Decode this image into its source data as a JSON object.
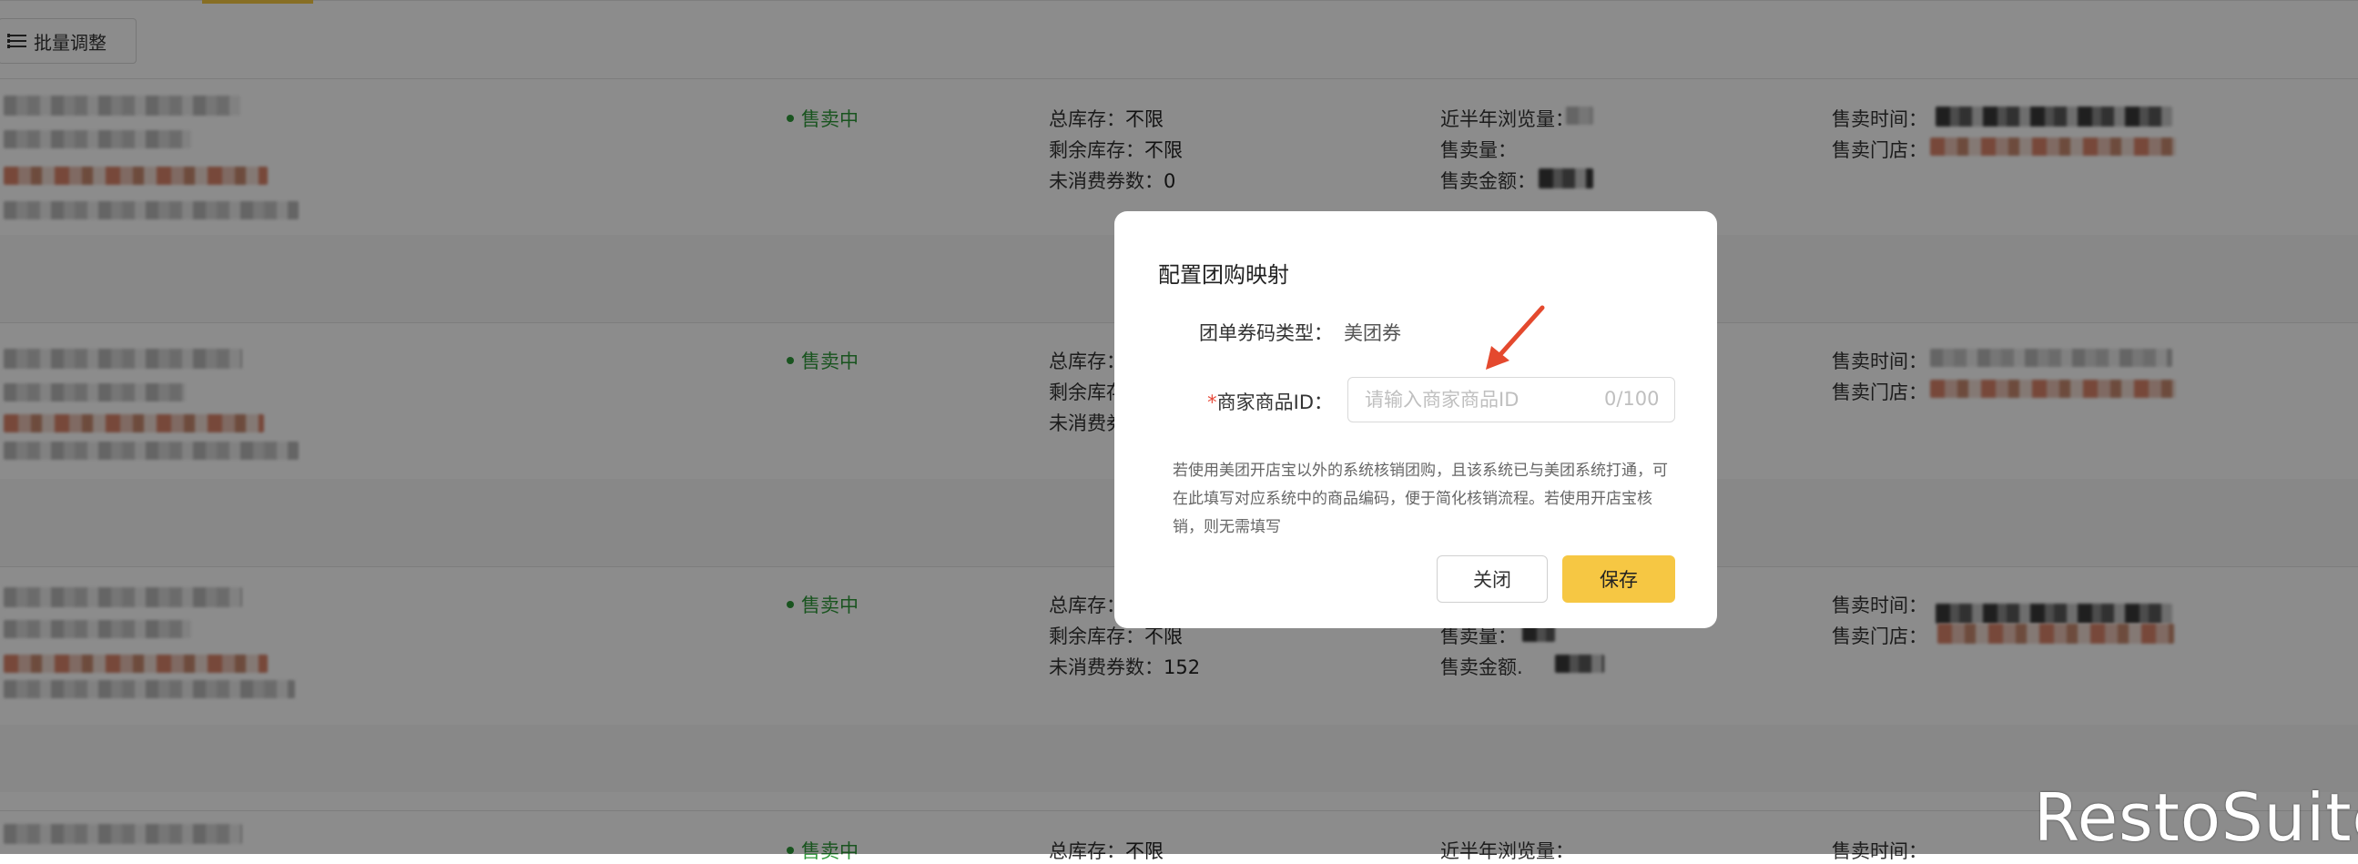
{
  "toolbar": {
    "batch_adjust_label": "批量调整"
  },
  "rows": [
    {
      "status": "售卖中",
      "stock_total_label": "总库存：",
      "stock_total_value": "不限",
      "stock_left_label": "剩余库存：",
      "stock_left_value": "不限",
      "unused_label": "未消费券数：",
      "unused_value": "0",
      "views_label": "近半年浏览量：",
      "sold_label": "售卖量：",
      "amount_label": "售卖金额：",
      "time_label": "售卖时间：",
      "store_label": "售卖门店："
    },
    {
      "status": "售卖中",
      "stock_total_label": "总库存：",
      "stock_left_label": "剩余库存",
      "unused_label": "未消费券",
      "time_label": "售卖时间：",
      "store_label": "售卖门店："
    },
    {
      "status": "售卖中",
      "stock_total_label": "总库存：",
      "stock_left_label": "剩余库存：",
      "stock_left_value": "不限",
      "unused_label": "未消费券数：",
      "unused_value": "152",
      "sold_label": "售卖量：",
      "amount_label": "售卖金额.",
      "time_label": "售卖时间：",
      "store_label": "售卖门店："
    },
    {
      "status": "售卖中",
      "stock_total_label": "总库存：",
      "stock_total_value": "不限",
      "views_label": "近半年浏览量：",
      "time_label": "售卖时间："
    }
  ],
  "modal": {
    "title": "配置团购映射",
    "coupon_type_label": "团单券码类型：",
    "coupon_type_value": "美团券",
    "merchant_id_required": "*",
    "merchant_id_label": "商家商品ID：",
    "merchant_id_placeholder": "请输入商家商品ID",
    "merchant_id_value": "",
    "merchant_id_counter": "0/100",
    "hint": "若使用美团开店宝以外的系统核销团购，且该系统已与美团系统打通，可在此填写对应系统中的商品编码，便于简化核销流程。若使用开店宝核销，则无需填写",
    "close_label": "关闭",
    "save_label": "保存"
  },
  "watermark": "RestoSuite",
  "colors": {
    "accent": "#f6c743",
    "status_green": "#2f9a3a",
    "required_red": "#e84a3a",
    "store_orange": "#e8632b"
  }
}
